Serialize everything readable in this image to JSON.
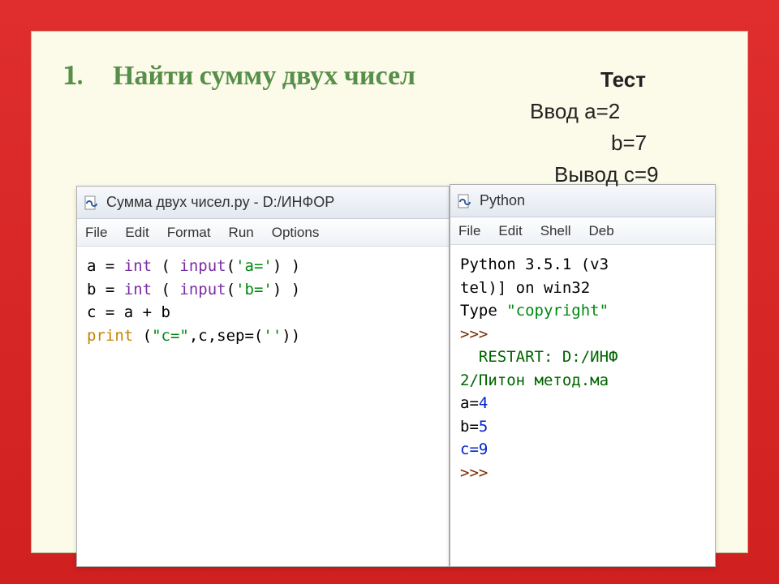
{
  "heading_num": "1.",
  "heading_text": "Найти сумму двух чисел",
  "test": {
    "title": "Тест",
    "line1": "Ввод a=2",
    "line2": "b=7",
    "line3": "Вывод c=9"
  },
  "editor": {
    "title": "Сумма двух чисел.py - D:/ИНФОР",
    "menu": [
      "File",
      "Edit",
      "Format",
      "Run",
      "Options"
    ],
    "code": {
      "l1a": "a = ",
      "l1b": "int",
      "l1c": " ( ",
      "l1d": "input",
      "l1e": "(",
      "l1f": "'a='",
      "l1g": ") )",
      "l2a": "b = ",
      "l2b": "int",
      "l2c": " ( ",
      "l2d": "input",
      "l2e": "(",
      "l2f": "'b='",
      "l2g": ") )",
      "l3": "c = a + b",
      "l4a": "print",
      "l4b": " (",
      "l4c": "\"c=\"",
      "l4d": ",c,sep=(",
      "l4e": "''",
      "l4f": "))"
    }
  },
  "shell": {
    "title": "Python",
    "menu": [
      "File",
      "Edit",
      "Shell",
      "Deb"
    ],
    "out": {
      "l1": "Python 3.5.1 (v3",
      "l2": "tel)] on win32",
      "l3a": "Type ",
      "l3b": "\"copyright\"",
      "l4": ">>>",
      "l5": "  RESTART: D:/ИНФ",
      "l6": "2/Питон метод.ма",
      "l7a": "a=",
      "l7b": "4",
      "l8a": "b=",
      "l8b": "5",
      "l9": "c=9",
      "l10": ">>>"
    }
  }
}
